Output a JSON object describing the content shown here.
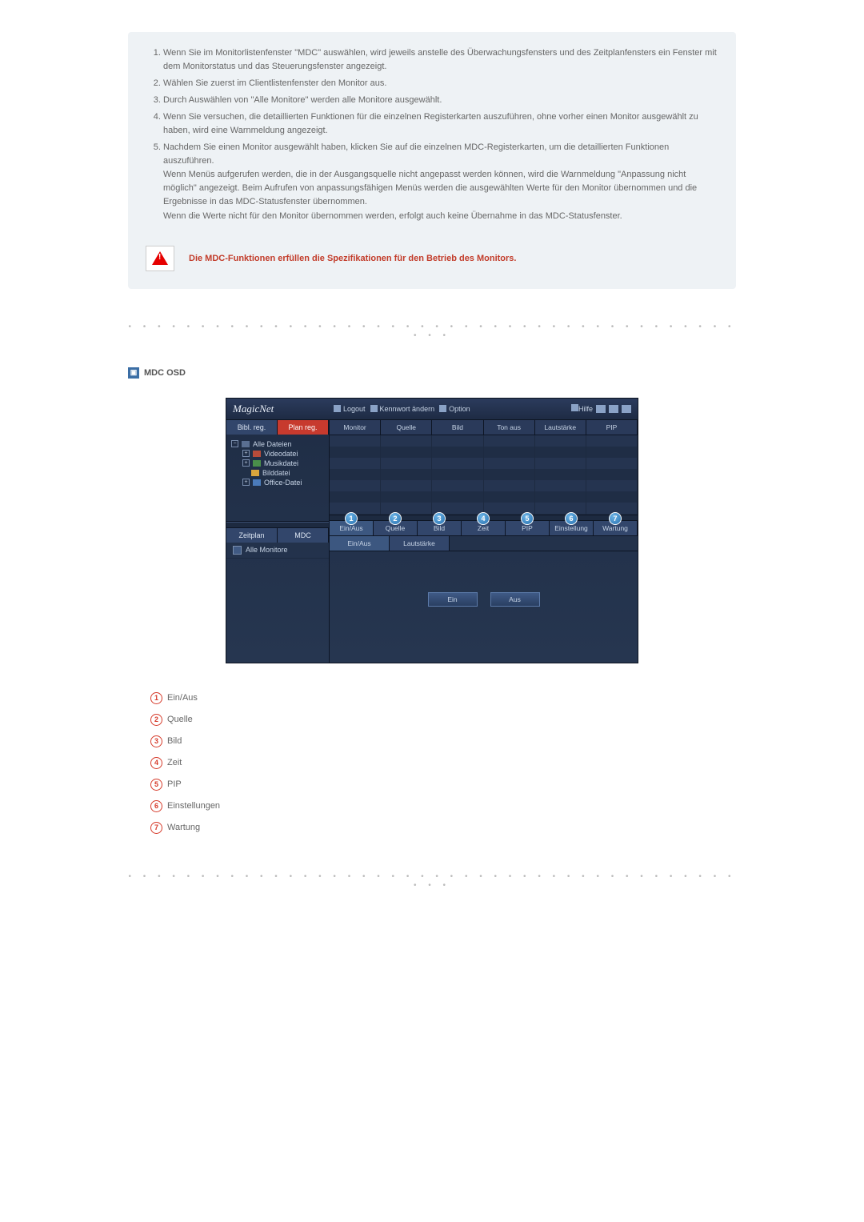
{
  "instructions": [
    "Wenn Sie im Monitorlistenfenster \"MDC\" auswählen, wird jeweils anstelle des Überwachungsfensters und des Zeitplanfensters ein Fenster mit dem Monitorstatus und das Steuerungsfenster angezeigt.",
    "Wählen Sie zuerst im Clientlistenfenster den Monitor aus.",
    "Durch Auswählen von \"Alle Monitore\" werden alle Monitore ausgewählt.",
    "Wenn Sie versuchen, die detaillierten Funktionen für die einzelnen Registerkarten auszuführen, ohne vorher einen Monitor ausgewählt zu haben, wird eine Warnmeldung angezeigt.",
    "Nachdem Sie einen Monitor ausgewählt haben, klicken Sie auf die einzelnen MDC-Registerkarten, um die detaillierten Funktionen auszuführen.\nWenn Menüs aufgerufen werden, die in der Ausgangsquelle nicht angepasst werden können, wird die Warnmeldung \"Anpassung nicht möglich\" angezeigt. Beim Aufrufen von anpassungsfähigen Menüs werden die ausgewählten Werte für den Monitor übernommen und die Ergebnisse in das MDC-Statusfenster übernommen.\nWenn die Werte nicht für den Monitor übernommen werden, erfolgt auch keine Übernahme in das MDC-Statusfenster."
  ],
  "warning": "Die MDC-Funktionen erfüllen die Spezifikationen für den Betrieb des Monitors.",
  "section_title": "MDC OSD",
  "screenshot": {
    "logo": "MagicNet",
    "toolbar": {
      "logout": "Logout",
      "kennwort": "Kennwort ändern",
      "option": "Option",
      "hilfe": "Hilfe"
    },
    "side_tabs": {
      "a": "Bibl. reg.",
      "b": "Plan reg."
    },
    "tree": {
      "root": "Alle Dateien",
      "items": [
        "Videodatei",
        "Musikdatei",
        "Bilddatei",
        "Office-Datei"
      ]
    },
    "side_tabs2": {
      "a": "Zeitplan",
      "b": "MDC"
    },
    "clients": {
      "all": "Alle Monitore"
    },
    "main_tabs": [
      "Monitor",
      "Quelle",
      "Bild",
      "Ton aus",
      "Lautstärke",
      "PIP"
    ],
    "mdc_tabs": [
      "Ein/Aus",
      "Quelle",
      "Bild",
      "Zeit",
      "PIP",
      "Einstellung",
      "Wartung"
    ],
    "detail_tabs": {
      "a": "Ein/Aus",
      "b": "Lautstärke"
    },
    "detail_buttons": {
      "on": "Ein",
      "off": "Aus"
    }
  },
  "legend": [
    "Ein/Aus",
    "Quelle",
    "Bild",
    "Zeit",
    "PIP",
    "Einstellungen",
    "Wartung"
  ]
}
